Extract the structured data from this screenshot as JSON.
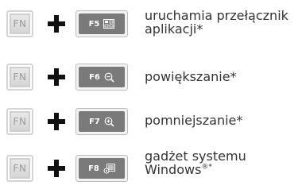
{
  "rows": [
    {
      "fn_key": "FN",
      "f_key": "F5",
      "f_key_icon": "app-switcher-icon",
      "desc_lines": [
        "uruchamia przełącznik",
        "aplikacji*"
      ]
    },
    {
      "fn_key": "FN",
      "f_key": "F6",
      "f_key_icon": "zoom-out-icon",
      "desc_lines": [
        "powiększanie*"
      ]
    },
    {
      "fn_key": "FN",
      "f_key": "F7",
      "f_key_icon": "zoom-in-icon",
      "desc_lines": [
        "pomniejszanie*"
      ]
    },
    {
      "fn_key": "FN",
      "f_key": "F8",
      "f_key_icon": "windows-gadget-icon",
      "desc_lines": [
        "gadżet systemu",
        "Windows"
      ],
      "desc_suffix": "®*"
    }
  ],
  "colors": {
    "key_face": "#7a7a7a",
    "fn_key_bg": "#d2d2d2",
    "plus": "#111111",
    "text": "#333333"
  }
}
